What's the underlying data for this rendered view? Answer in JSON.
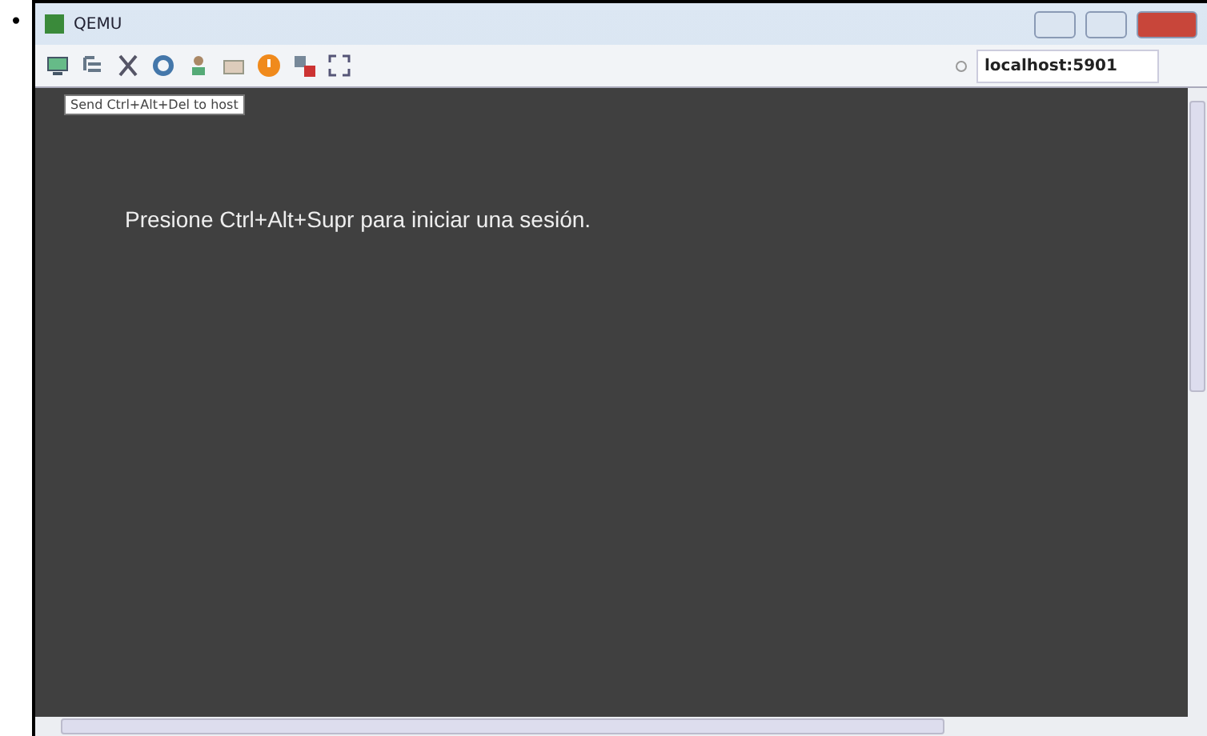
{
  "bullet": "•",
  "window": {
    "title": "QEMU"
  },
  "toolbar": {
    "tooltip": "Send Ctrl+Alt+Del to host",
    "address": "localhost:5901"
  },
  "screen": {
    "message": "Presione Ctrl+Alt+Supr para iniciar una sesión."
  }
}
